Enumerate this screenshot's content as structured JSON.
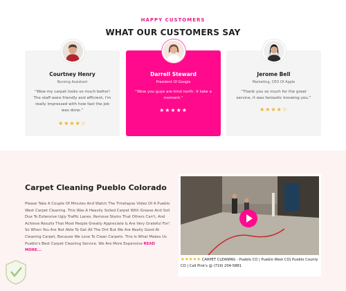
{
  "testimonials": {
    "eyebrow": "HAPPY CUSTOMERS",
    "title": "WHAT OUR CUSTOMERS SAY",
    "cards": [
      {
        "name": "Courtney Henry",
        "role": "Nursing Assistant",
        "quote": "“Wow my carpet looks so much better! The staff were friendly and efficient, I'm really impressed with how fast the job was done.”",
        "stars": "★★★★☆",
        "rating": 4.5
      },
      {
        "name": "Darrell Steward",
        "role": "President Of Google",
        "quote": "“Wow you guys are kind north. it take a moment.”",
        "stars": "★★★★★",
        "rating": 5
      },
      {
        "name": "Jerome Bell",
        "role": "Marketing, CEO Of Apple",
        "quote": "“Thank you so much for the great service, it was fantastic knowing you.”",
        "stars": "★★★★☆",
        "rating": 4.5
      }
    ]
  },
  "promo": {
    "title": "Carpet Cleaning Pueblo Colorado",
    "body": "Please Take A Couple Of Minutes And Watch The Timelapse Video Of A Pueblo West Carpet Cleaning. This Was A Heavily Soiled Carpet With Grease And Soil Due To Extensive Ugly Traffic Lanes. Remove Stains That Others Can't, And Achieve Results That Most People Greatly Appreciate & Are Very Grateful For! So When You Are Not Able To Get All The Dirt But We Are Really Good At Cleaning Carpet, Because We Love To Clean Carpets. This Is What Makes Us Pueblo's Best Carpet Cleaning Service. We Are More Expensive",
    "read_more": "READ MORE...",
    "video": {
      "caption_stars": "★★★★★",
      "caption": "CARPET CLEANING - Pueblo CO | Pueblo West CO| Pueblo County CO | Call Pink's @ (719) 204-5881"
    }
  },
  "colors": {
    "accent": "#ff0a8c",
    "star": "#f2b01e",
    "promo_bg": "#fdf3f3",
    "card_bg": "#f4f4f4"
  },
  "icons": {
    "play": "play-icon",
    "badge": "certification-badge-icon"
  }
}
